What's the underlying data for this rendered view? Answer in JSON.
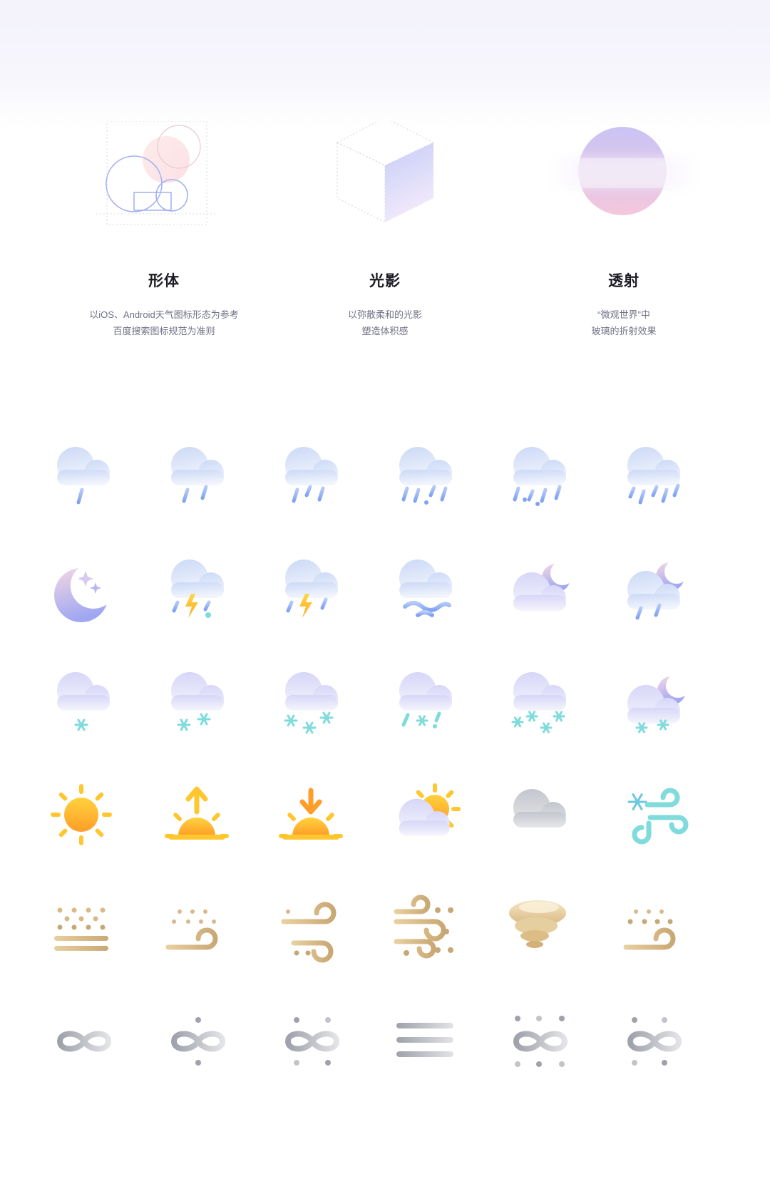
{
  "principles": [
    {
      "title": "形体",
      "desc": [
        "以iOS、Android天气图标形态为参考",
        "百度搜索图标规范为准则"
      ]
    },
    {
      "title": "光影",
      "desc": [
        "以弥散柔和的光影",
        "塑造体积感"
      ]
    },
    {
      "title": "透射",
      "desc": [
        "“微观世界”中",
        "玻璃的折射效果"
      ]
    }
  ],
  "colors": {
    "cloud": "#dde6f8",
    "rain": "#8fb1f5",
    "snow": "#7fdbdc",
    "sun": "#ffb02e",
    "sand": "#d9b98a",
    "fog": "#b4b6bd",
    "moon": "#b7b5f3",
    "lightning": "#ffc533"
  },
  "icon_grid": [
    [
      "cloud-light-rain-icon",
      "cloud-moderate-rain-icon",
      "cloud-heavy-rain-icon",
      "cloud-rainstorm-icon",
      "cloud-heavy-rainstorm-icon",
      "cloud-extreme-rainstorm-icon"
    ],
    [
      "moon-stars-icon",
      "thunderstorm-hail-icon",
      "thunderstorm-icon",
      "cloud-wind-icon",
      "cloudy-night-icon",
      "night-shower-icon"
    ],
    [
      "cloud-light-snow-icon",
      "cloud-moderate-snow-icon",
      "cloud-heavy-snow-icon",
      "cloud-sleet-icon",
      "cloud-blizzard-icon",
      "night-snow-icon"
    ],
    [
      "sun-icon",
      "sunrise-icon",
      "sunset-icon",
      "partly-cloudy-icon",
      "overcast-icon",
      "blowing-snow-icon"
    ],
    [
      "floating-dust-icon",
      "blowing-sand-icon",
      "sandstorm-icon",
      "severe-sandstorm-icon",
      "tornado-icon",
      "dust-wind-icon"
    ],
    [
      "fog-icon",
      "haze-icon",
      "moderate-haze-icon",
      "mist-icon",
      "heavy-haze-icon",
      "severe-haze-icon"
    ]
  ]
}
